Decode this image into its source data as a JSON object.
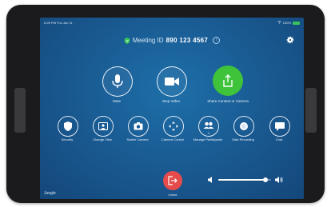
{
  "status_bar": {
    "time": "6:25 PM  Thu Jun 11",
    "battery": "100%"
  },
  "meeting": {
    "label": "Meeting ID",
    "id": "890 123 4567"
  },
  "big_controls": [
    {
      "label": "Mute",
      "icon": "microphone-icon"
    },
    {
      "label": "Stop Video",
      "icon": "video-camera-icon"
    },
    {
      "label": "Share Content or Camera",
      "icon": "share-upload-icon"
    }
  ],
  "small_controls": [
    {
      "label": "Security",
      "icon": "shield-icon"
    },
    {
      "label": "Change View",
      "icon": "gallery-view-icon"
    },
    {
      "label": "Switch Camera",
      "icon": "switch-camera-icon"
    },
    {
      "label": "Camera Control",
      "icon": "camera-control-arrows-icon"
    },
    {
      "label": "Manage Participants",
      "icon": "participants-icon",
      "badge": "1"
    },
    {
      "label": "Start Recording",
      "icon": "record-icon"
    },
    {
      "label": "Chat",
      "icon": "chat-bubble-icon"
    }
  ],
  "leave": {
    "label": "Leave",
    "icon": "exit-icon"
  },
  "volume": {
    "level": 0.9
  },
  "room_name": "Jungle",
  "colors": {
    "background": "#1a5c94",
    "share": "#3ec33b",
    "leave": "#e64b4b",
    "secure": "#37c55b"
  }
}
